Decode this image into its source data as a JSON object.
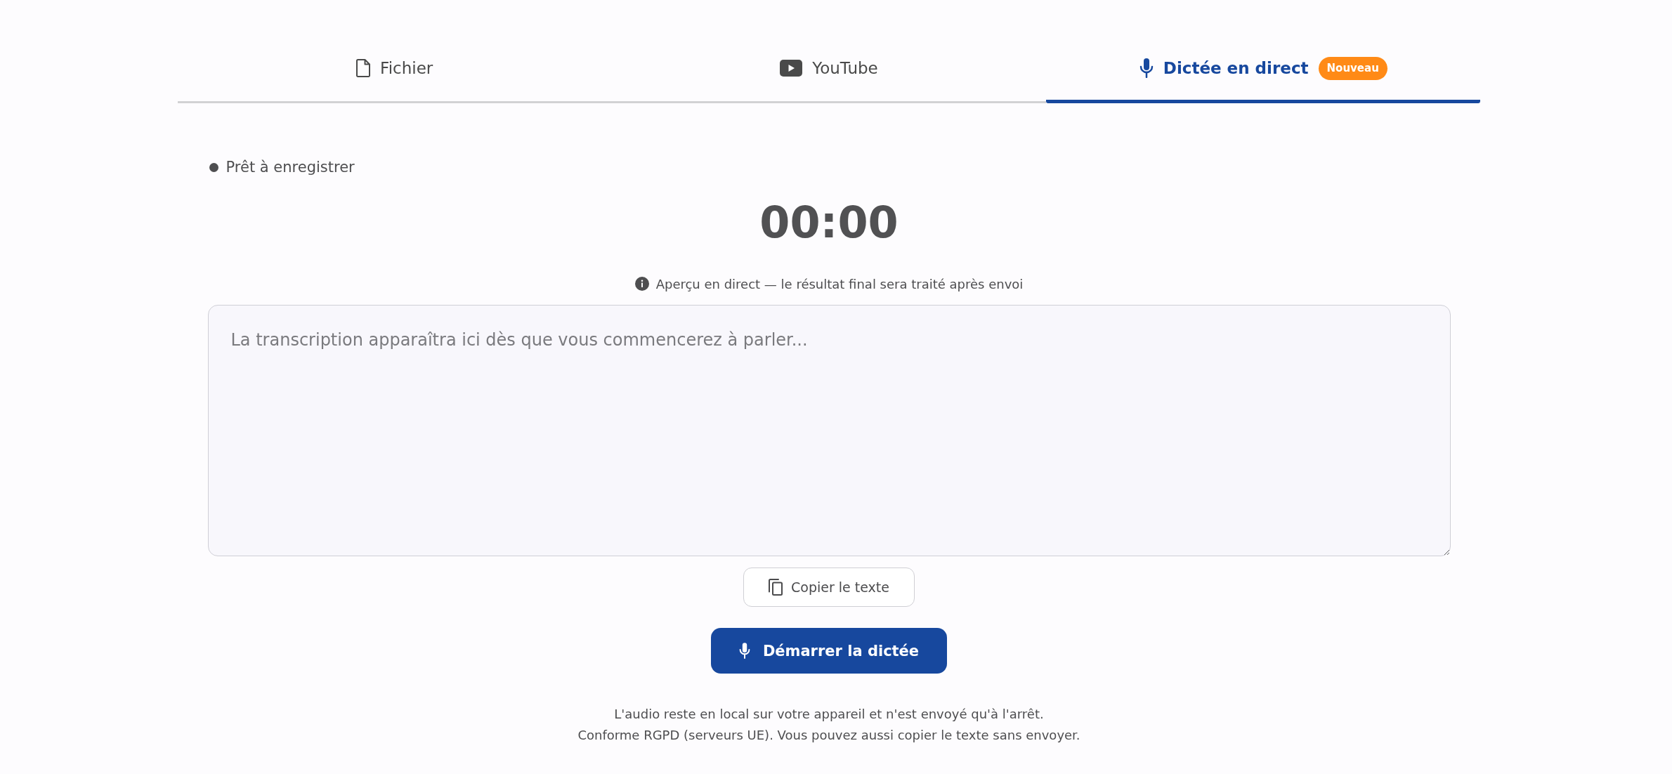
{
  "tabs": [
    {
      "kind": "file",
      "label": "Fichier",
      "selected": false
    },
    {
      "kind": "youtube",
      "label": "YouTube",
      "selected": false
    },
    {
      "kind": "mic",
      "label": "Dictée en direct",
      "selected": true,
      "badge": "Nouveau"
    }
  ],
  "status": {
    "label": "Prêt à enregistrer"
  },
  "timer": "00:00",
  "info_note": "Aperçu en direct — le résultat final sera traité après envoi",
  "transcript": {
    "placeholder": "La transcription apparaîtra ici dès que vous commencerez à parler..."
  },
  "copy_button": {
    "label": "Copier le texte"
  },
  "start_button": {
    "label": "Démarrer la dictée"
  },
  "footer": [
    "L'audio reste en local sur votre appareil et n'est envoyé qu'à l'arrêt.",
    "Conforme RGPD (serveurs UE). Vous pouvez aussi copier le texte sans envoyer."
  ]
}
